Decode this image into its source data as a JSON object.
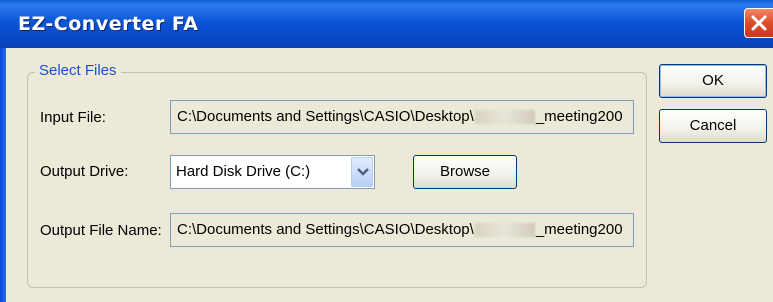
{
  "window": {
    "title": "EZ-Converter FA"
  },
  "group": {
    "legend": "Select Files"
  },
  "input_file": {
    "label": "Input File:",
    "value_prefix": "C:\\Documents and Settings\\CASIO\\Desktop\\",
    "value_suffix": "_meeting200"
  },
  "output_drive": {
    "label": "Output Drive:",
    "selected": "Hard Disk Drive (C:)"
  },
  "browse_label": "Browse",
  "output_file_name": {
    "label": "Output File Name:",
    "value_prefix": "C:\\Documents and Settings\\CASIO\\Desktop\\",
    "value_suffix": "_meeting200"
  },
  "buttons": {
    "ok": "OK",
    "cancel": "Cancel"
  },
  "colors": {
    "titlebar": "#0a48c6",
    "dialog_bg": "#ece9d8",
    "group_legend": "#1a4fd0",
    "close_button": "#e0502c"
  },
  "icons": {
    "close": "close-icon",
    "dropdown": "chevron-down-icon"
  }
}
